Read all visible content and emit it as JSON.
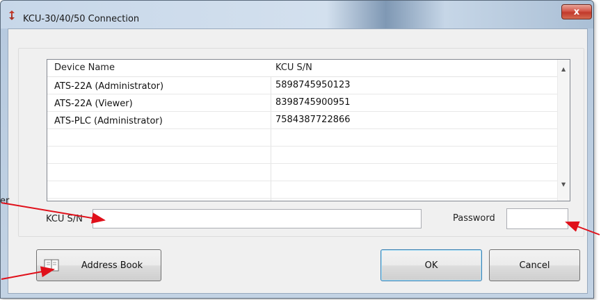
{
  "window": {
    "title": "KCU-30/40/50 Connection",
    "close_glyph": "x"
  },
  "table": {
    "columns": [
      "Device Name",
      "KCU S/N"
    ],
    "rows": [
      {
        "device": "ATS-22A (Administrator)",
        "sn": "5898745950123"
      },
      {
        "device": "ATS-22A (Viewer)",
        "sn": "8398745900951"
      },
      {
        "device": "ATS-PLC (Administrator)",
        "sn": "7584387722866"
      },
      {
        "device": "",
        "sn": ""
      },
      {
        "device": "",
        "sn": ""
      },
      {
        "device": "",
        "sn": ""
      },
      {
        "device": "",
        "sn": ""
      }
    ]
  },
  "form": {
    "kcu_label": "KCU S/N",
    "kcu_value": "",
    "password_label": "Password",
    "password_value": ""
  },
  "buttons": {
    "address_book": "Address Book",
    "ok": "OK",
    "cancel": "Cancel"
  },
  "annotations": {
    "edge_text": "er",
    "arrow_color": "#e0101a"
  },
  "icons": {
    "title": "app-icon",
    "book": "address-book-icon"
  }
}
